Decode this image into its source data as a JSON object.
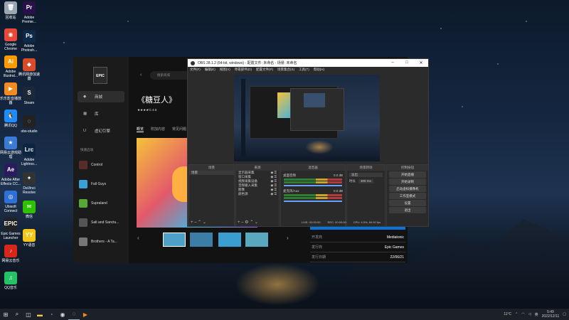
{
  "desktop": {
    "icons": [
      {
        "label": "回收站",
        "glyph": "🗑",
        "color": "#9aa7b3"
      },
      {
        "label": "Google Chrome",
        "glyph": "◉",
        "color": "#e5493a"
      },
      {
        "label": "Adobe Illustrat...",
        "glyph": "Ai",
        "color": "#ff9a00"
      },
      {
        "label": "乐乐影音播放器",
        "glyph": "▶",
        "color": "#f28b22"
      },
      {
        "label": "腾讯QQ",
        "glyph": "🐧",
        "color": "#1e8cff"
      },
      {
        "label": "网易云游戏助理",
        "glyph": "★",
        "color": "#3a7bd5"
      },
      {
        "label": "Adobe After Effects CC...",
        "glyph": "Ae",
        "color": "#2a1a5e"
      },
      {
        "label": "Ubisoft Connect",
        "glyph": "◎",
        "color": "#2e6fd8"
      },
      {
        "label": "Epic Games Launcher",
        "glyph": "EPIC",
        "color": "#222"
      },
      {
        "label": "网易云音乐",
        "glyph": "♪",
        "color": "#d9261c"
      },
      {
        "label": "QQ音乐",
        "glyph": "♫",
        "color": "#25c266"
      }
    ],
    "icons2": [
      {
        "label": "Adobe Premie...",
        "glyph": "Pr",
        "color": "#2a0f4a"
      },
      {
        "label": "Adobe Photosh...",
        "glyph": "Ps",
        "color": "#0b2a4a"
      },
      {
        "label": "腾讯网游加速器",
        "glyph": "◆",
        "color": "#d94c2a"
      },
      {
        "label": "Steam",
        "glyph": "S",
        "color": "#1b2838"
      },
      {
        "label": "obs-studio",
        "glyph": "◌",
        "color": "#222"
      },
      {
        "label": "Adobe Lightroo...",
        "glyph": "Lrc",
        "color": "#0c2540"
      },
      {
        "label": "DaVinci Resolve",
        "glyph": "✦",
        "color": "#333"
      },
      {
        "label": "微信",
        "glyph": "✉",
        "color": "#2dc100"
      },
      {
        "label": "YY语音",
        "glyph": "YY",
        "color": "#f5c518"
      }
    ]
  },
  "epic": {
    "logo": "EPIC",
    "search_placeholder": "搜索商城",
    "nav": [
      {
        "icon": "◆",
        "label": "商城"
      },
      {
        "icon": "▦",
        "label": "库"
      },
      {
        "icon": "U",
        "label": "虚幻引擎"
      }
    ],
    "fav_title": "快速启动",
    "favorites": [
      {
        "name": "Control",
        "color": "#5a2b2b"
      },
      {
        "name": "Fall Guys",
        "color": "#3aa0d8"
      },
      {
        "name": "Supraland",
        "color": "#58a836"
      },
      {
        "name": "Salt and Sanctu...",
        "color": "#555"
      },
      {
        "name": "Brothers - A Ta...",
        "color": "#777"
      }
    ],
    "game_title": "《糖豆人》",
    "rating": "★★★★½  4.5",
    "tabs": [
      "概览",
      "附加内容",
      "常见问题"
    ],
    "info_rows": [
      {
        "k": "开发商",
        "v": "Mediatonic"
      },
      {
        "k": "发行商",
        "v": "Epic Games"
      },
      {
        "k": "发行日期",
        "v": "22/06/21"
      }
    ]
  },
  "obs": {
    "title": "OBS 28.1.2 (64-bit, windows) - 配置文件: 未命名 - 场景: 未命名",
    "menu": [
      "文件(F)",
      "编辑(E)",
      "视图(V)",
      "停靠部件(D)",
      "配置文件(P)",
      "场景集合(S)",
      "工具(T)",
      "帮助(H)"
    ],
    "panel_heads": [
      "场景",
      "来源",
      "混音器",
      "场景转场",
      "控制按钮"
    ],
    "scene": "场景",
    "sources": [
      "显示器采集",
      "窗口采集",
      "视频采集设备",
      "音频输入采集",
      "图像",
      "颜色源"
    ],
    "mixer": [
      {
        "name": "桌面音频",
        "db": "0.0 dB"
      },
      {
        "name": "麦克风/Aux",
        "db": "0.0 dB"
      }
    ],
    "transition": {
      "type": "淡出",
      "duration_label": "时长",
      "duration": "300 ms"
    },
    "controls": [
      "开始直播",
      "开始录制",
      "启动虚拟摄像机",
      "工作室模式",
      "设置",
      "退出"
    ],
    "status": {
      "live": "LIVE: 00:00:00",
      "rec": "REC: 00:00:00",
      "cpu": "CPU: 4.0%, 60.00 fps"
    }
  },
  "taskbar": {
    "weather": "11°C",
    "time": "5:49",
    "date": "2022/12/11",
    "ime": "英"
  }
}
